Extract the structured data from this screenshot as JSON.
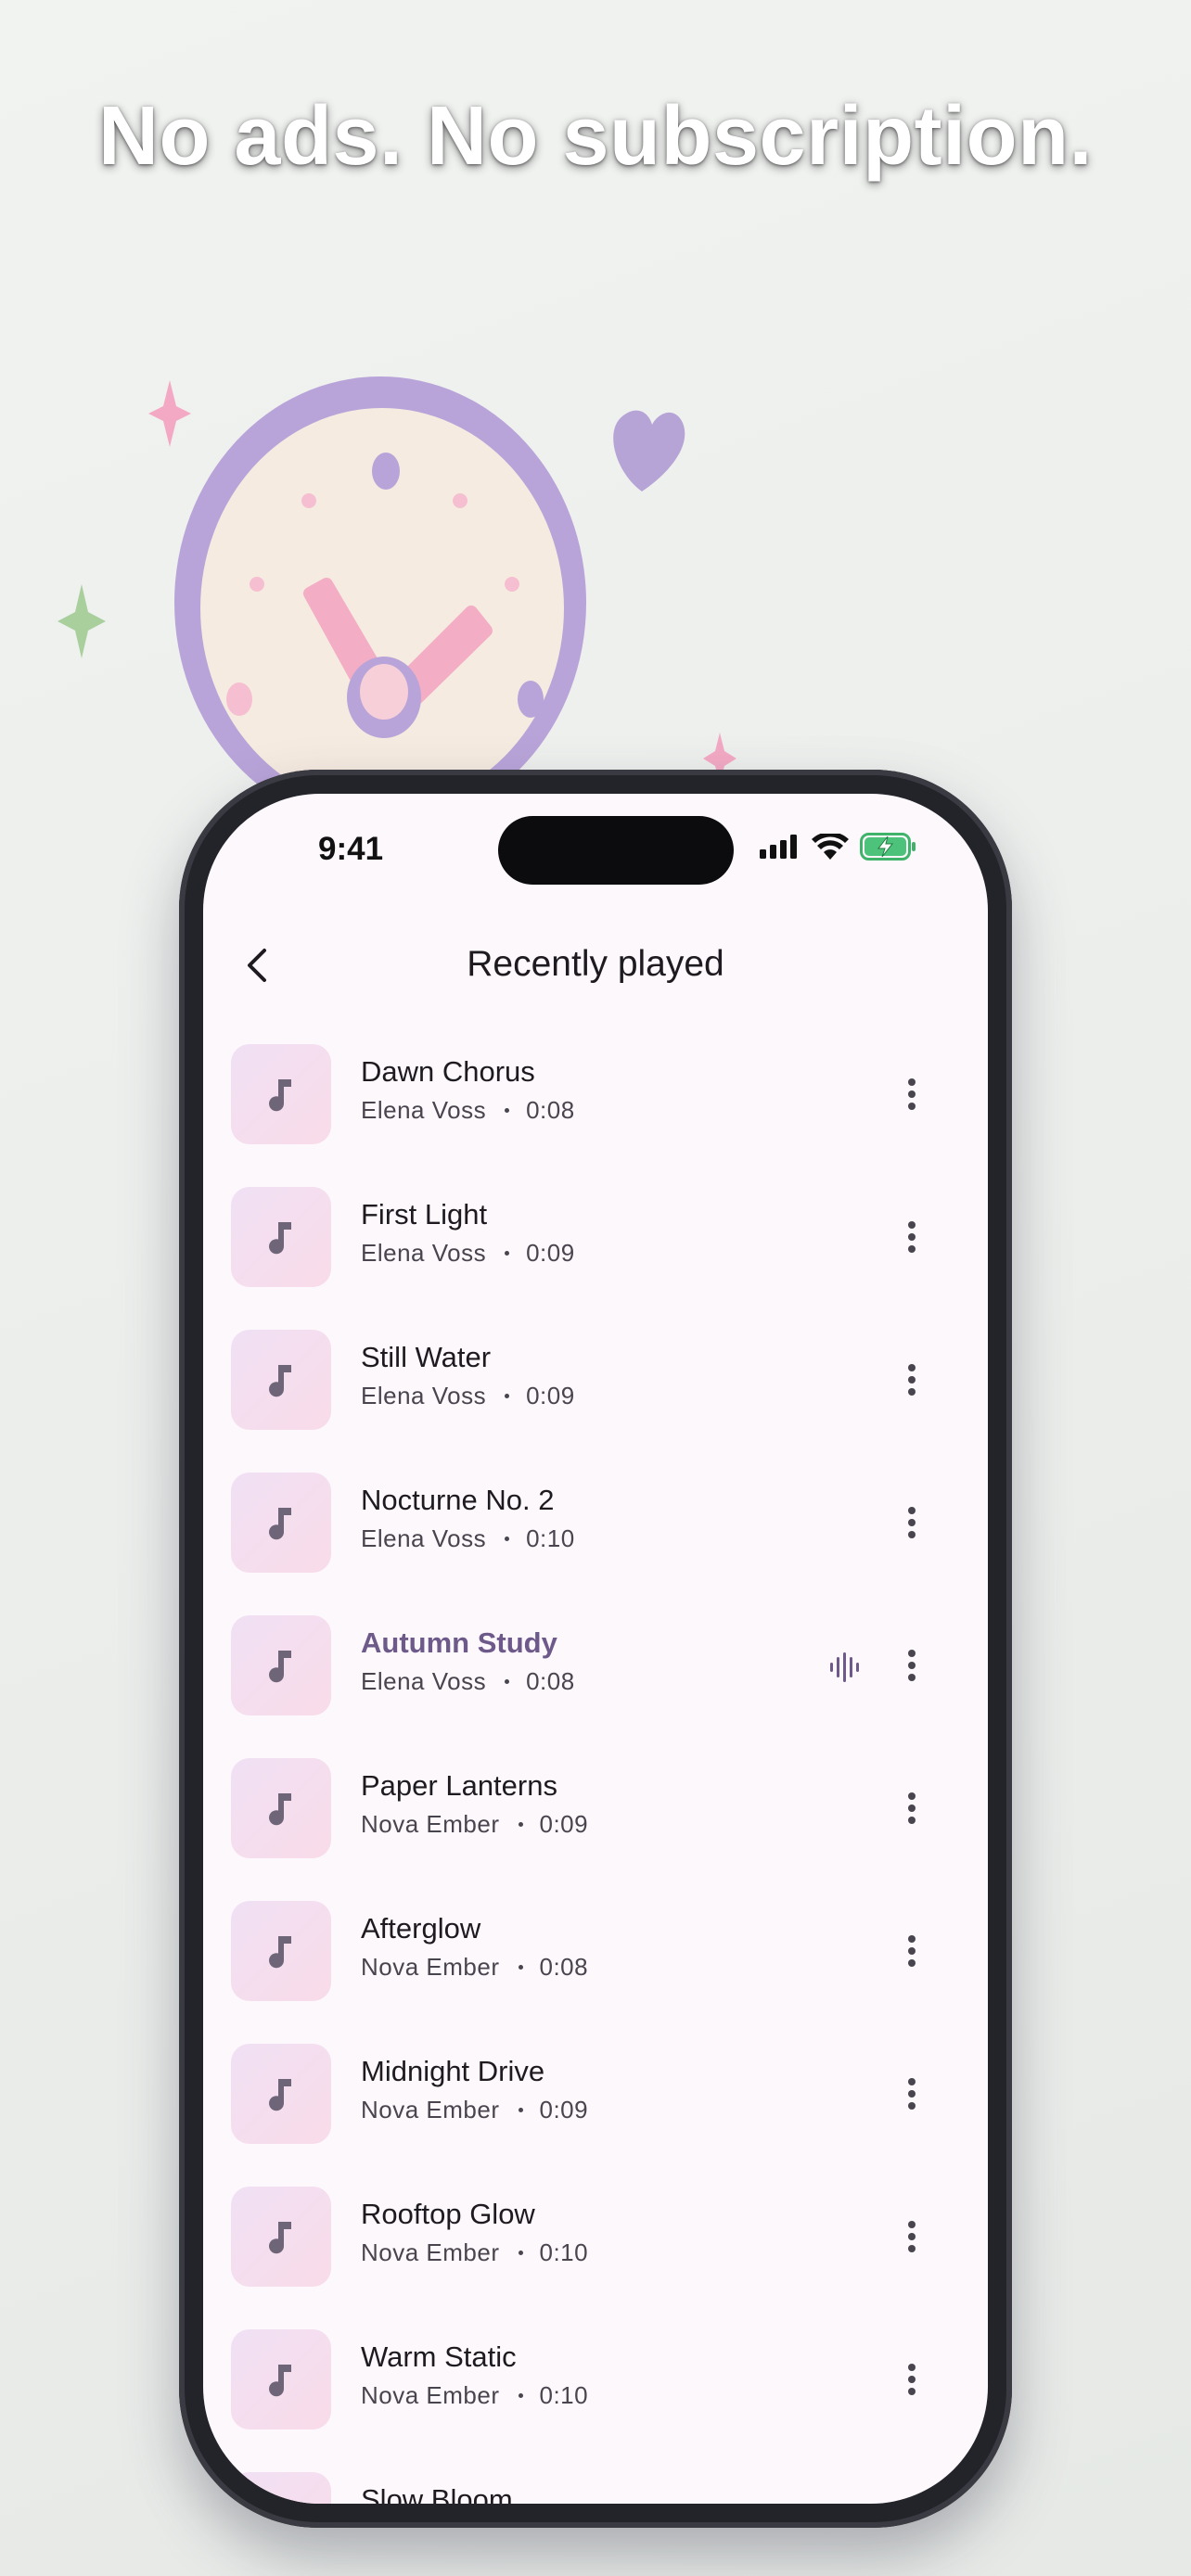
{
  "headline": "No ads. No subscription.",
  "status_bar": {
    "time": "9:41"
  },
  "header": {
    "title": "Recently played",
    "back_icon": "chevron-left-icon"
  },
  "colors": {
    "accent": "#6d5a8a",
    "background": "#fdf8fc",
    "thumb_gradient_start": "#f0e1f4",
    "thumb_gradient_end": "#f9dbe9"
  },
  "tracks": [
    {
      "title": "Dawn Chorus",
      "artist": "Elena Voss",
      "duration": "0:08",
      "playing": false
    },
    {
      "title": "First Light",
      "artist": "Elena Voss",
      "duration": "0:09",
      "playing": false
    },
    {
      "title": "Still Water",
      "artist": "Elena Voss",
      "duration": "0:09",
      "playing": false
    },
    {
      "title": "Nocturne No. 2",
      "artist": "Elena Voss",
      "duration": "0:10",
      "playing": false
    },
    {
      "title": "Autumn Study",
      "artist": "Elena Voss",
      "duration": "0:08",
      "playing": true
    },
    {
      "title": "Paper Lanterns",
      "artist": "Nova Ember",
      "duration": "0:09",
      "playing": false
    },
    {
      "title": "Afterglow",
      "artist": "Nova Ember",
      "duration": "0:08",
      "playing": false
    },
    {
      "title": "Midnight Drive",
      "artist": "Nova Ember",
      "duration": "0:09",
      "playing": false
    },
    {
      "title": "Rooftop Glow",
      "artist": "Nova Ember",
      "duration": "0:10",
      "playing": false
    },
    {
      "title": "Warm Static",
      "artist": "Nova Ember",
      "duration": "0:10",
      "playing": false
    },
    {
      "title": "Slow Bloom",
      "artist": "",
      "duration": "",
      "playing": false
    }
  ]
}
